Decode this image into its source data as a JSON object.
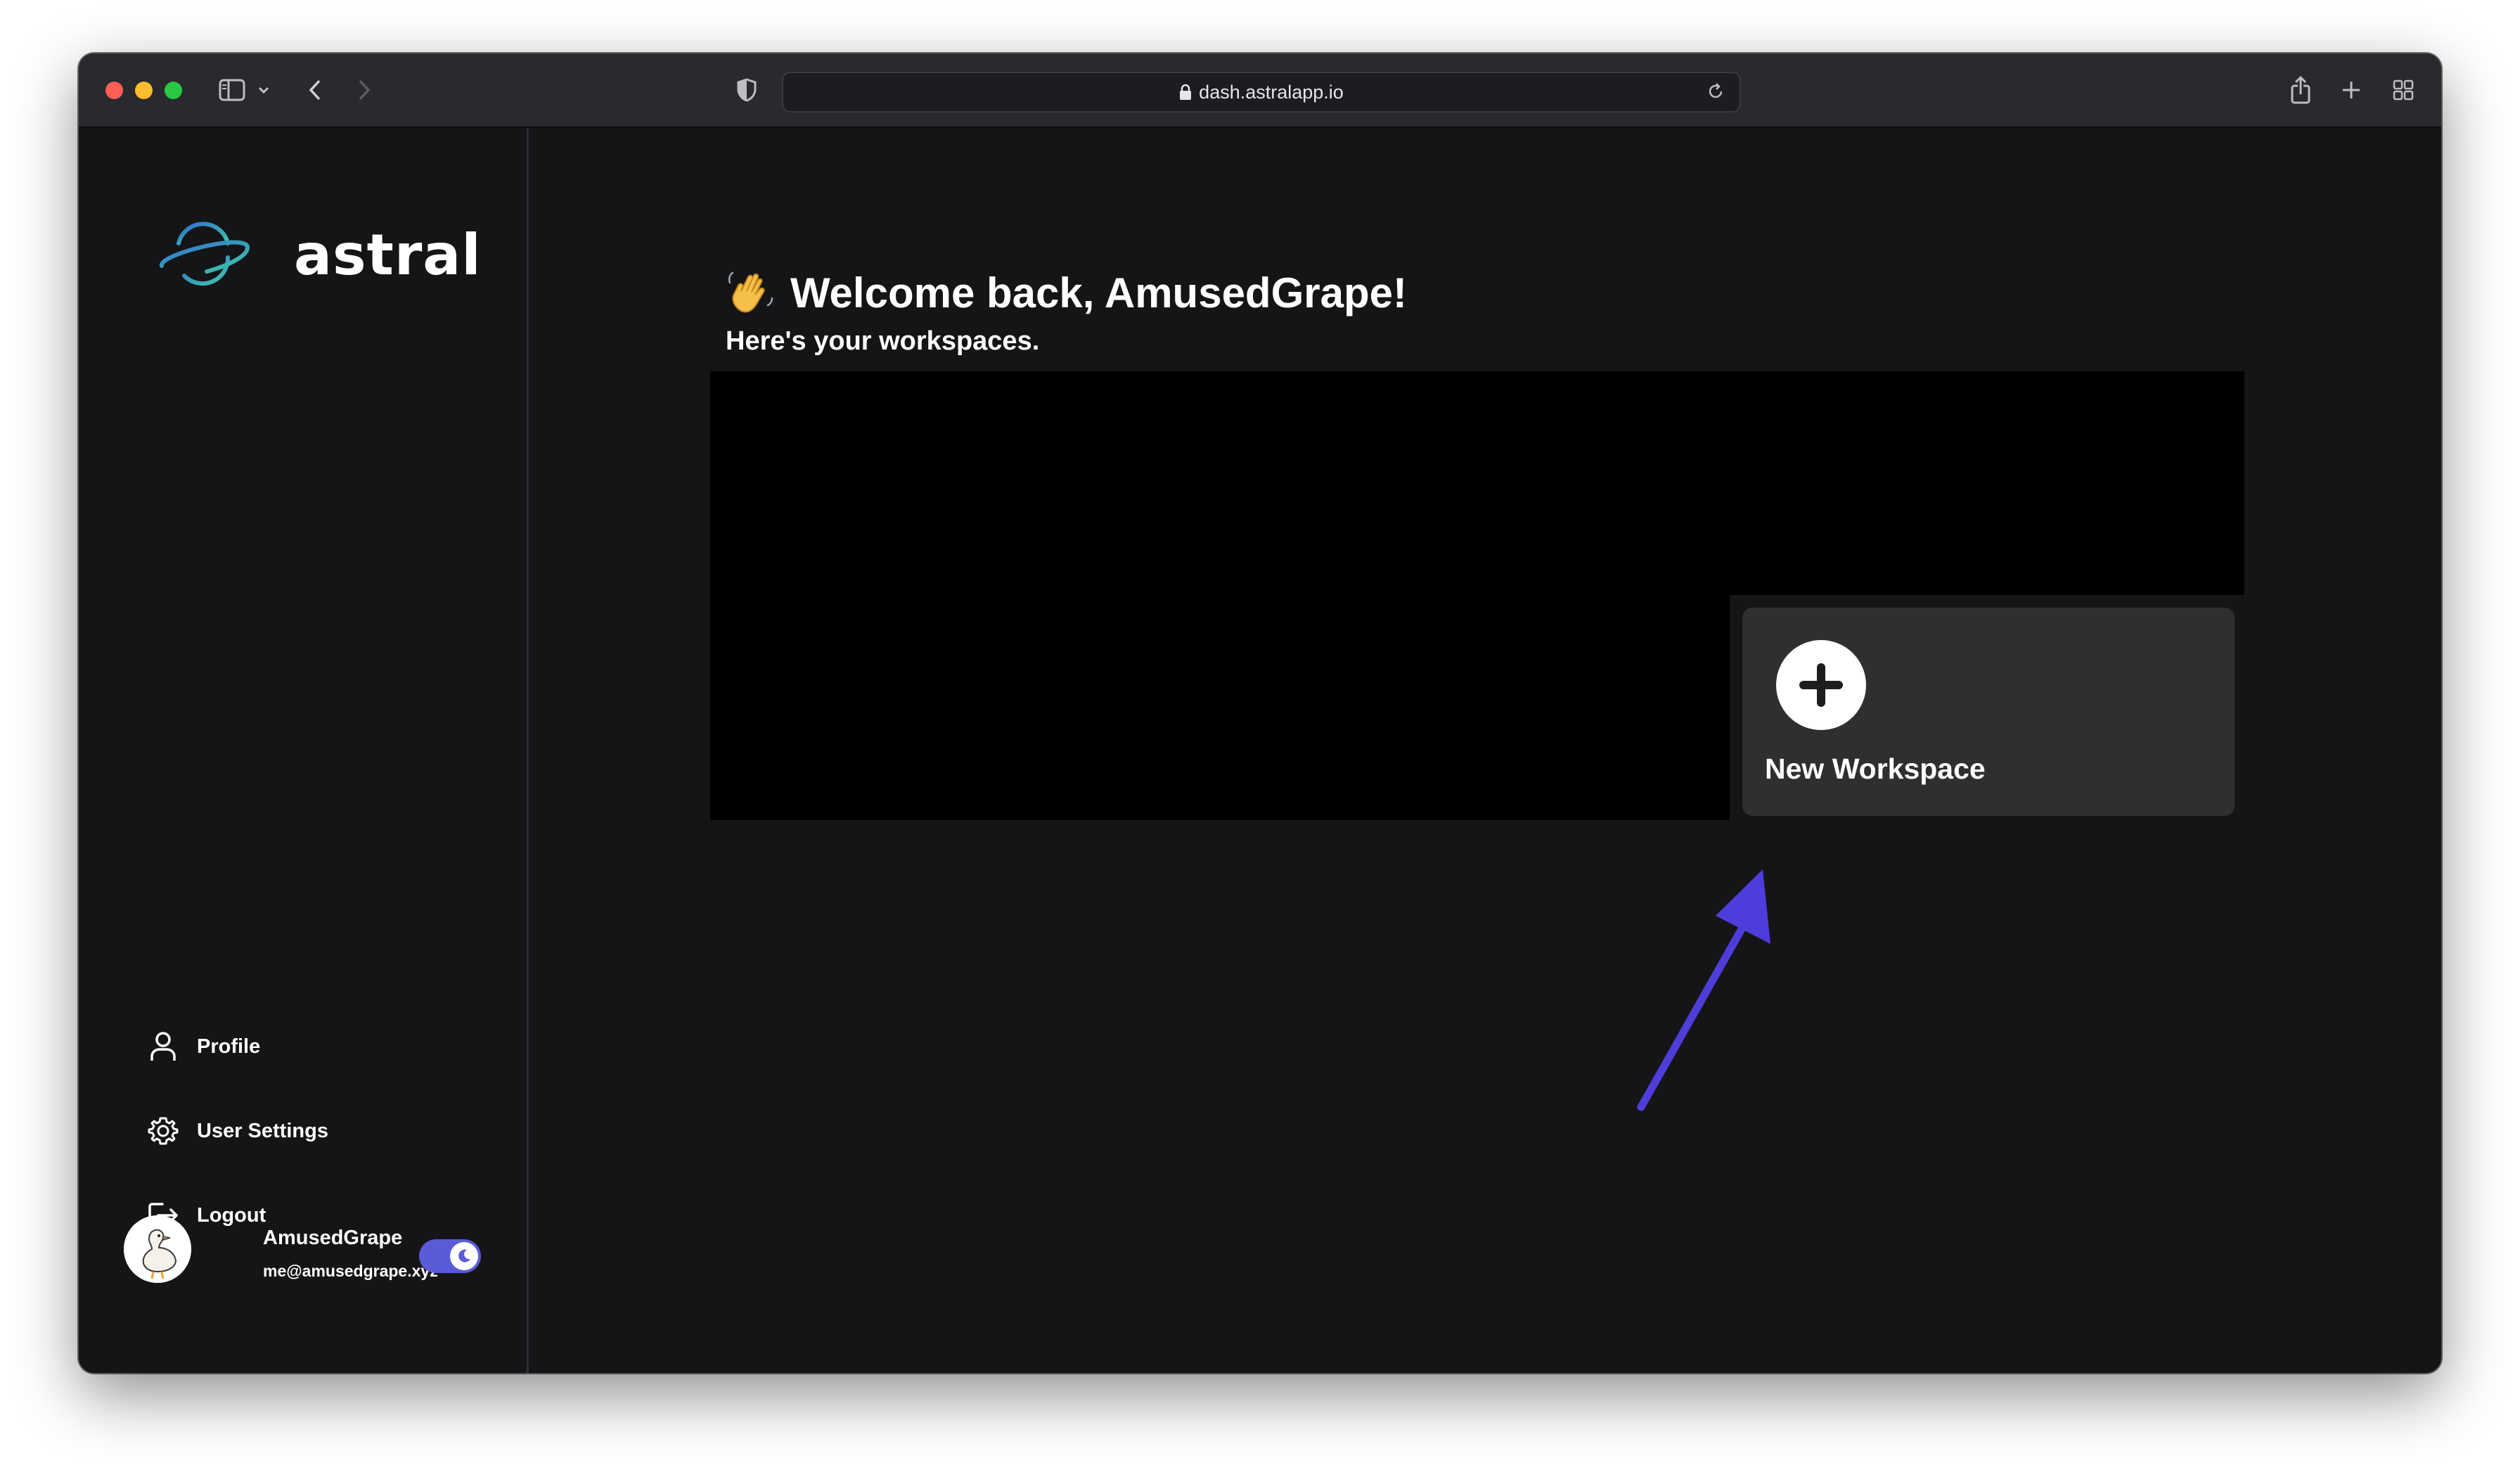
{
  "browser": {
    "url": "dash.astralapp.io"
  },
  "sidebar": {
    "logo_text": "astral",
    "nav": [
      {
        "label": "Profile",
        "icon": "user-icon"
      },
      {
        "label": "User Settings",
        "icon": "gear-icon"
      },
      {
        "label": "Logout",
        "icon": "logout-icon"
      }
    ],
    "user": {
      "name": "AmusedGrape",
      "email": "me@amusedgrape.xyz",
      "dark_mode": true
    }
  },
  "main": {
    "wave_emoji": "👋",
    "welcome": "Welcome back, AmusedGrape!",
    "subtitle": "Here's your workspaces.",
    "new_workspace_label": "New Workspace"
  },
  "colors": {
    "accent": "#5b5bd8",
    "annotation_arrow": "#4f3ddb",
    "background": "#151517",
    "card": "#2f2f31"
  }
}
